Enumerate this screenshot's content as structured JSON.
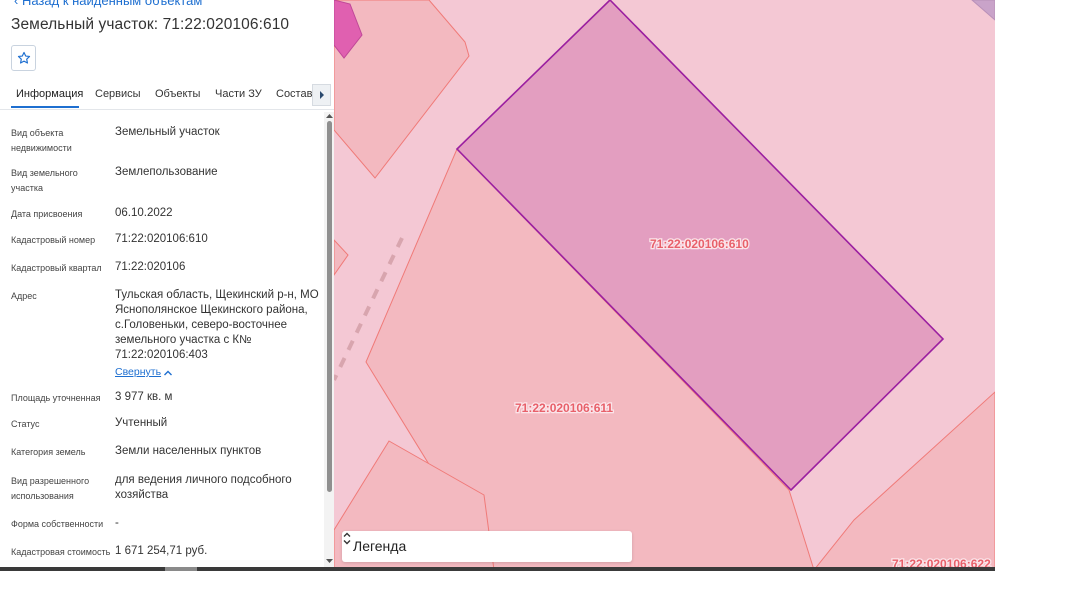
{
  "panel": {
    "back_link": "Назад к найденным объектам",
    "title": "Земельный участок: 71:22:020106:610",
    "favorite_icon": "star-icon",
    "tabs": [
      {
        "label": "Информация",
        "active": true
      },
      {
        "label": "Сервисы",
        "active": false
      },
      {
        "label": "Объекты",
        "active": false
      },
      {
        "label": "Части ЗУ",
        "active": false
      },
      {
        "label": "Состав",
        "active": false
      }
    ],
    "tabs_more_icon": "chevron-right-icon",
    "fields": [
      {
        "label": "Вид объекта недвижимости",
        "value": "Земельный участок"
      },
      {
        "label": "Вид земельного участка",
        "value": "Землепользование"
      },
      {
        "label": "Дата присвоения",
        "value": "06.10.2022"
      },
      {
        "label": "Кадастровый номер",
        "value": "71:22:020106:610"
      },
      {
        "label": "Кадастровый квартал",
        "value": "71:22:020106"
      },
      {
        "label": "Адрес",
        "value": "Тульская область, Щекинский р-н, МО Яснополянское Щекинского района, с.Головеньки, северо-восточнее земельного участка с К№ 71:22:020106:403"
      },
      {
        "label": "Площадь уточненная",
        "value": "3 977 кв. м"
      },
      {
        "label": "Статус",
        "value": "Учтенный"
      },
      {
        "label": "Категория земель",
        "value": "Земли населенных пунктов"
      },
      {
        "label": "Вид разрешенного использования",
        "value": "для ведения личного подсобного хозяйства"
      },
      {
        "label": "Форма собственности",
        "value": "-"
      },
      {
        "label": "Кадастровая стоимость",
        "value": "1 671 254,71 руб."
      }
    ],
    "collapse_label": "Свернуть"
  },
  "map": {
    "parcels": [
      {
        "label": "71:22:020106:610",
        "fill": "#e39ec0",
        "stroke": "#9b1fa0",
        "selected": true
      },
      {
        "label": "71:22:020106:611",
        "fill": "#f3b9c0",
        "stroke": "#f07a78"
      },
      {
        "label": "71:22:020106:622",
        "fill": "#f3b9c0",
        "stroke": "#f07a78"
      }
    ],
    "background": "#f4c8d4",
    "legend_label": "Легенда"
  }
}
